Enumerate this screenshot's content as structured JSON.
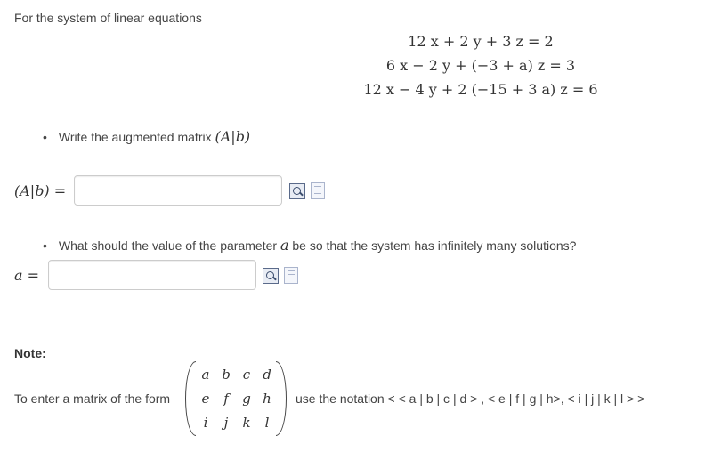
{
  "intro": "For the system of linear equations",
  "equations": [
    "12 x + 2 y + 3 z = 2",
    "6 x − 2 y + (−3 + a) z = 3",
    "12 x − 4 y + 2 (−15 + 3 a) z = 6"
  ],
  "part1": {
    "bullet": "•",
    "prompt": "Write the augmented matrix",
    "prompt_math": "(A|b)",
    "label": "(A|b) =",
    "input_value": "",
    "input_placeholder": ""
  },
  "part2": {
    "bullet": "•",
    "prompt_before": "What should the value of the parameter",
    "prompt_math": "a",
    "prompt_after": "be so that the system has infinitely many solutions?",
    "label": "a =",
    "input_value": "",
    "input_placeholder": ""
  },
  "note": {
    "heading": "Note:",
    "text_before": "To enter a matrix of the form",
    "matrix": [
      [
        "a",
        "b",
        "c",
        "d"
      ],
      [
        "e",
        "f",
        "g",
        "h"
      ],
      [
        "i",
        "j",
        "k",
        "l"
      ]
    ],
    "text_after": "use the notation < < a | b | c  | d > , < e | f | g | h>, < i | j | k | l > >"
  }
}
